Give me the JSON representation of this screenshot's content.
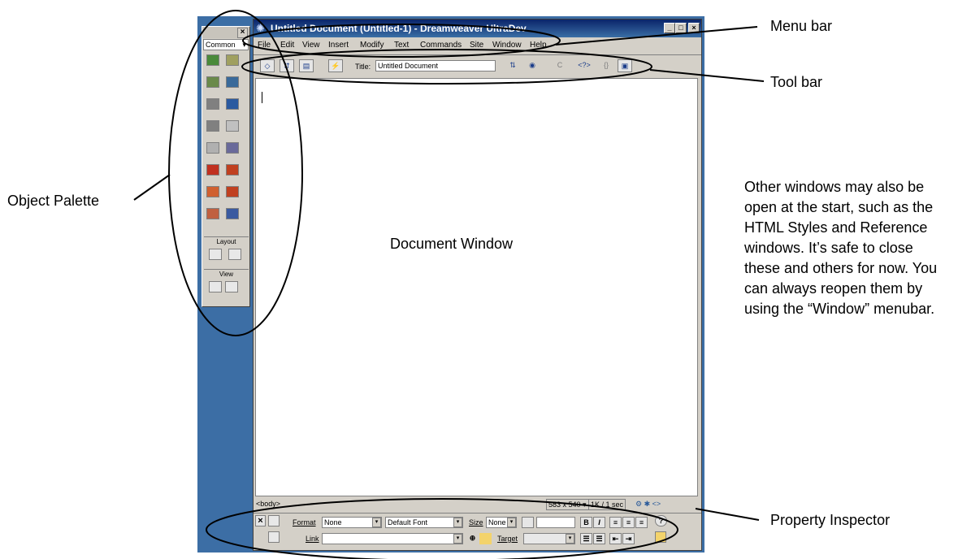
{
  "palette": {
    "category": "Common",
    "close_glyph": "×",
    "dropdown_glyph": "▾",
    "sections": {
      "layout": "Layout",
      "view": "View"
    },
    "icons": [
      "insert-image-icon",
      "insert-rollover-icon",
      "insert-table-icon",
      "tabular-data-icon",
      "insert-layer-icon",
      "navigation-bar-icon",
      "horizontal-rule-icon",
      "email-link-icon",
      "date-icon",
      "server-side-include-icon",
      "flash-icon",
      "shockwave-icon",
      "generator-icon",
      "fireworks-html-icon",
      "applet-icon",
      "activex-icon"
    ]
  },
  "window": {
    "title": "Untitled Document (Untitled-1) - Dreamweaver UltraDev",
    "app_icon": "✺",
    "controls": {
      "minimize": "_",
      "maximize": "□",
      "close": "×"
    },
    "menu": [
      "File",
      "Edit",
      "View",
      "Insert",
      "Modify",
      "Text",
      "Commands",
      "Site",
      "Window",
      "Help"
    ],
    "toolbar": {
      "title_label": "Title:",
      "title_value": "Untitled Document",
      "buttons": {
        "code": "◇",
        "split": "⇵",
        "design": "▤",
        "assets": "⚡",
        "file_mgmt": "⇅",
        "preview": "◉",
        "refresh": "C",
        "reference": "<?>",
        "code_nav": "{}",
        "view_options": "▣"
      }
    }
  },
  "statusbar": {
    "tag": "<body>",
    "size": "583 x 540 ▾",
    "download": "1K / 1 sec",
    "launcher": "⚙ ✱ <>"
  },
  "inspector": {
    "close_glyph": "×",
    "format_label": "Format",
    "format_value": "None",
    "font_value": "Default Font",
    "size_label": "Size",
    "size_value": "None",
    "bold": "B",
    "italic": "I",
    "align": [
      "≡",
      "≡",
      "≡"
    ],
    "list": [
      "☰",
      "☰",
      "⇤",
      "⇥"
    ],
    "help": "?",
    "link_label": "Link",
    "link_value": "",
    "target_label": "Target",
    "target_value": ""
  },
  "annotations": {
    "menu_bar": "Menu bar",
    "tool_bar": "Tool bar",
    "object_palette": "Object Palette",
    "document_window": "Document Window",
    "property_inspector": "Property Inspector",
    "note": "Other windows may also be open at the start, such as the HTML Styles and Reference windows. It’s safe to close these and others for now. You can always reopen them by using the “Window” menubar."
  },
  "colors": {
    "desktop": "#3c6ea5",
    "chrome": "#d4d0c8",
    "titlebar": "#0a246a"
  }
}
